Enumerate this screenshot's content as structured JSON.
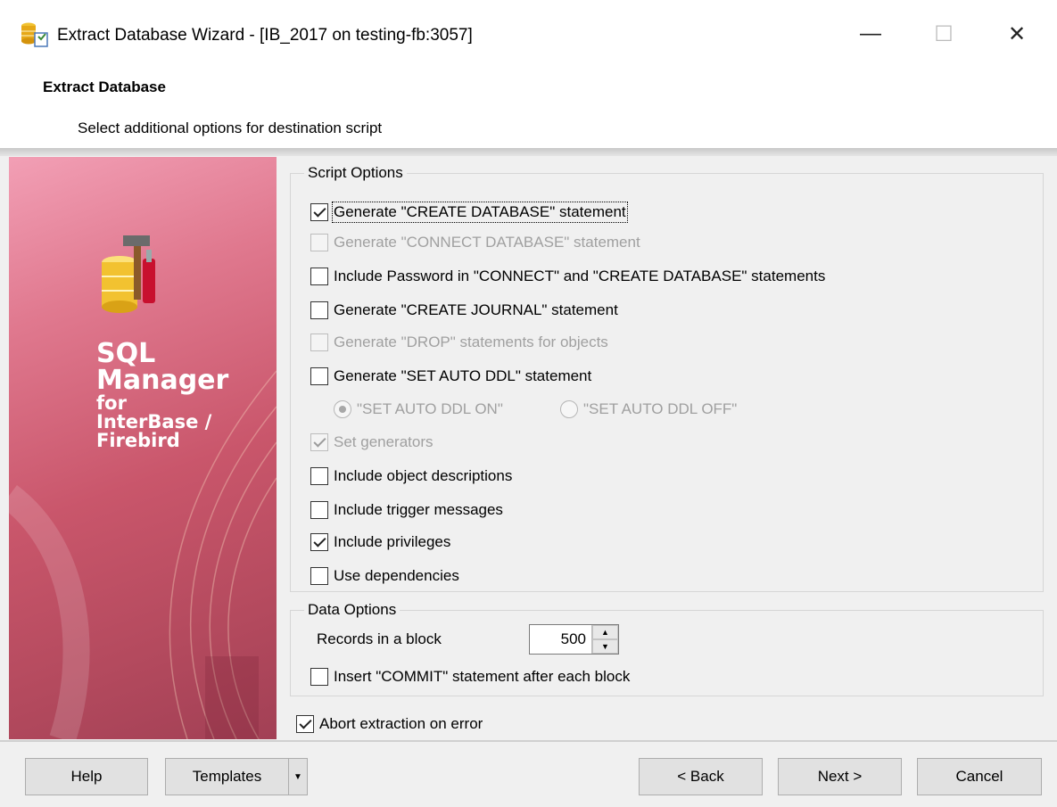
{
  "window": {
    "title": "Extract Database Wizard - [IB_2017 on testing-fb:3057]",
    "minimize_glyph": "—",
    "maximize_glyph": "☐",
    "close_glyph": "✕"
  },
  "header": {
    "title": "Extract Database",
    "subtitle": "Select additional options for destination script"
  },
  "banner": {
    "line1": "SQL",
    "line2": "Manager",
    "line3": "for",
    "line4": "InterBase /",
    "line5": "Firebird"
  },
  "script_options": {
    "caption": "Script Options",
    "items": [
      {
        "label": "Generate \"CREATE DATABASE\" statement",
        "checked": true,
        "enabled": true
      },
      {
        "label": "Generate \"CONNECT DATABASE\" statement",
        "checked": false,
        "enabled": false
      },
      {
        "label": "Include Password in \"CONNECT\" and \"CREATE DATABASE\" statements",
        "checked": false,
        "enabled": true
      },
      {
        "label": "Generate \"CREATE JOURNAL\" statement",
        "checked": false,
        "enabled": true
      },
      {
        "label": "Generate \"DROP\" statements for objects",
        "checked": false,
        "enabled": false
      },
      {
        "label": "Generate \"SET AUTO DDL\" statement",
        "checked": false,
        "enabled": true
      },
      {
        "label": "Set generators",
        "checked": true,
        "enabled": false
      },
      {
        "label": "Include object descriptions",
        "checked": false,
        "enabled": true
      },
      {
        "label": "Include trigger messages",
        "checked": false,
        "enabled": true
      },
      {
        "label": "Include privileges",
        "checked": true,
        "enabled": true
      },
      {
        "label": "Use dependencies",
        "checked": false,
        "enabled": true
      }
    ],
    "radio_on": "\"SET AUTO DDL ON\"",
    "radio_off": "\"SET AUTO DDL OFF\"",
    "radio_selected": "on"
  },
  "data_options": {
    "caption": "Data Options",
    "records_label": "Records in a block",
    "records_value": "500",
    "commit_label": "Insert \"COMMIT\" statement after each block",
    "commit_checked": false
  },
  "abort": {
    "label": "Abort extraction on error",
    "checked": true
  },
  "footer": {
    "help": "Help",
    "templates": "Templates",
    "back": "< Back",
    "next": "Next >",
    "cancel": "Cancel"
  }
}
